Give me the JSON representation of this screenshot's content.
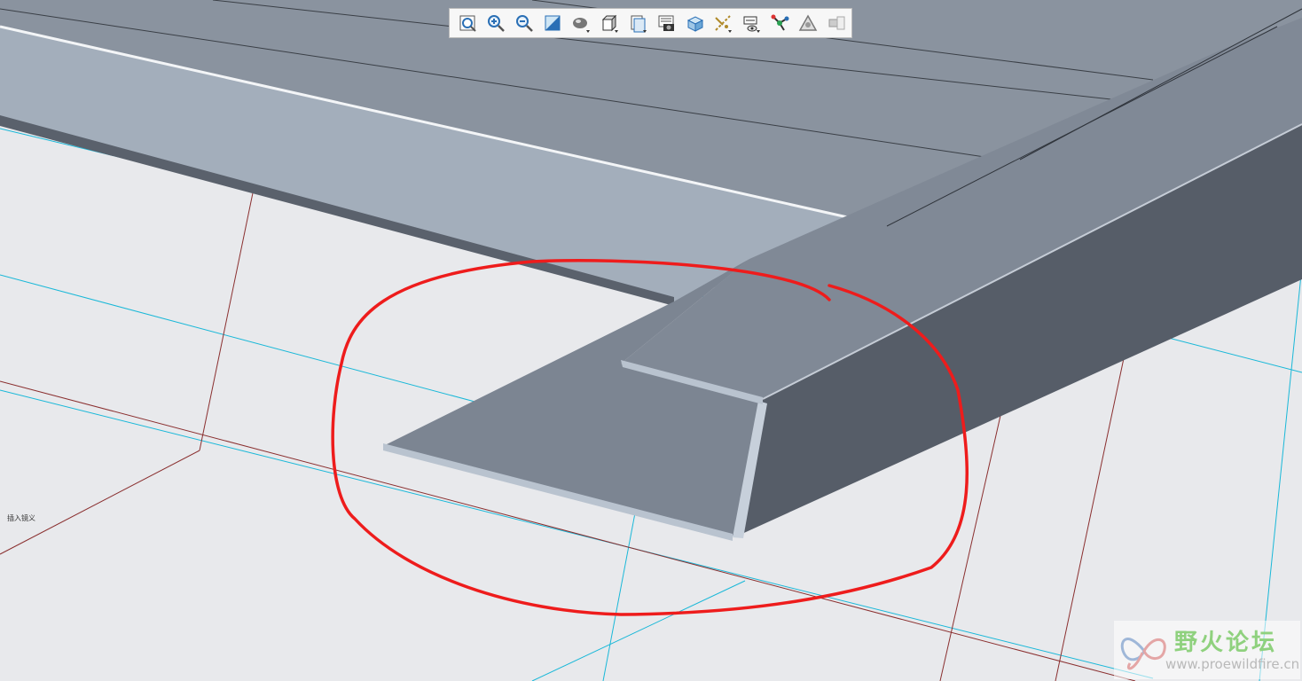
{
  "toolbar": {
    "items": [
      {
        "name": "refit-icon"
      },
      {
        "name": "zoom-in-icon"
      },
      {
        "name": "zoom-out-icon"
      },
      {
        "name": "repaint-icon"
      },
      {
        "name": "display-style-icon"
      },
      {
        "name": "saved-orientations-icon"
      },
      {
        "name": "view-manager-icon"
      },
      {
        "name": "perspective-icon"
      },
      {
        "name": "section-icon"
      },
      {
        "name": "datum-display-icon"
      },
      {
        "name": "annotation-display-icon"
      },
      {
        "name": "spin-center-icon"
      },
      {
        "name": "appearance-icon"
      },
      {
        "name": "layer-display-icon"
      }
    ]
  },
  "canvas_note": "插入镜义",
  "watermark": {
    "title": "野火论坛",
    "url": "www.proewildfire.cn"
  },
  "colors": {
    "background": "#e8e9ec",
    "part_light": "#a3aebb",
    "part_mid": "#7e8793",
    "part_dark": "#5a616c",
    "datum_cyan": "#19b8d8",
    "datum_red": "#8a2f2f",
    "markup_red": "#ee1c1c"
  }
}
